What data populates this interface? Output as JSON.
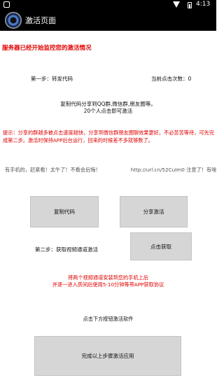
{
  "status_bar": {
    "time": "4:13"
  },
  "app_bar": {
    "title": "激活页面"
  },
  "server_notice": "服务器已经开始监控您的激活情况",
  "step1": {
    "label": "第一步：转发代码",
    "count_label": "当前点击次数：",
    "count_value": "0"
  },
  "instructions": {
    "line1": "复制代码分享到QQ群,微信群,朋友圈等。",
    "line2": "20个人点击即可激活"
  },
  "tip": "提示：分享的群越多被点击速度越快，分享到微信群朋友圈聊效果更好。不必苦苦等待，可先完成第二步。激活时保持APP后台运行，回来的时候差不多就够数了。",
  "share_text": "有手机的，赶紧看！太牛了！不看会后悔！　　　　　　http://url.cn/52CuIm0  注意了！有啥恋",
  "buttons": {
    "copy_code": "复制代码",
    "share_activate": "分享激活",
    "click_get": "点击获取",
    "complete": "完成以上步骤激活应用"
  },
  "step2": {
    "label": "第二步：获取视频通道激活"
  },
  "install_note": {
    "line1": "将两个视频通道安装到您的手机上后",
    "line2": "并逐一进入房间后使用5-10分钟等带APP获取协议"
  },
  "bottom_hint": "点击下方按钮激活软件",
  "colors": {
    "alert_red": "#e00000",
    "button_gray": "#d6d6d6",
    "bar_black": "#000000"
  }
}
